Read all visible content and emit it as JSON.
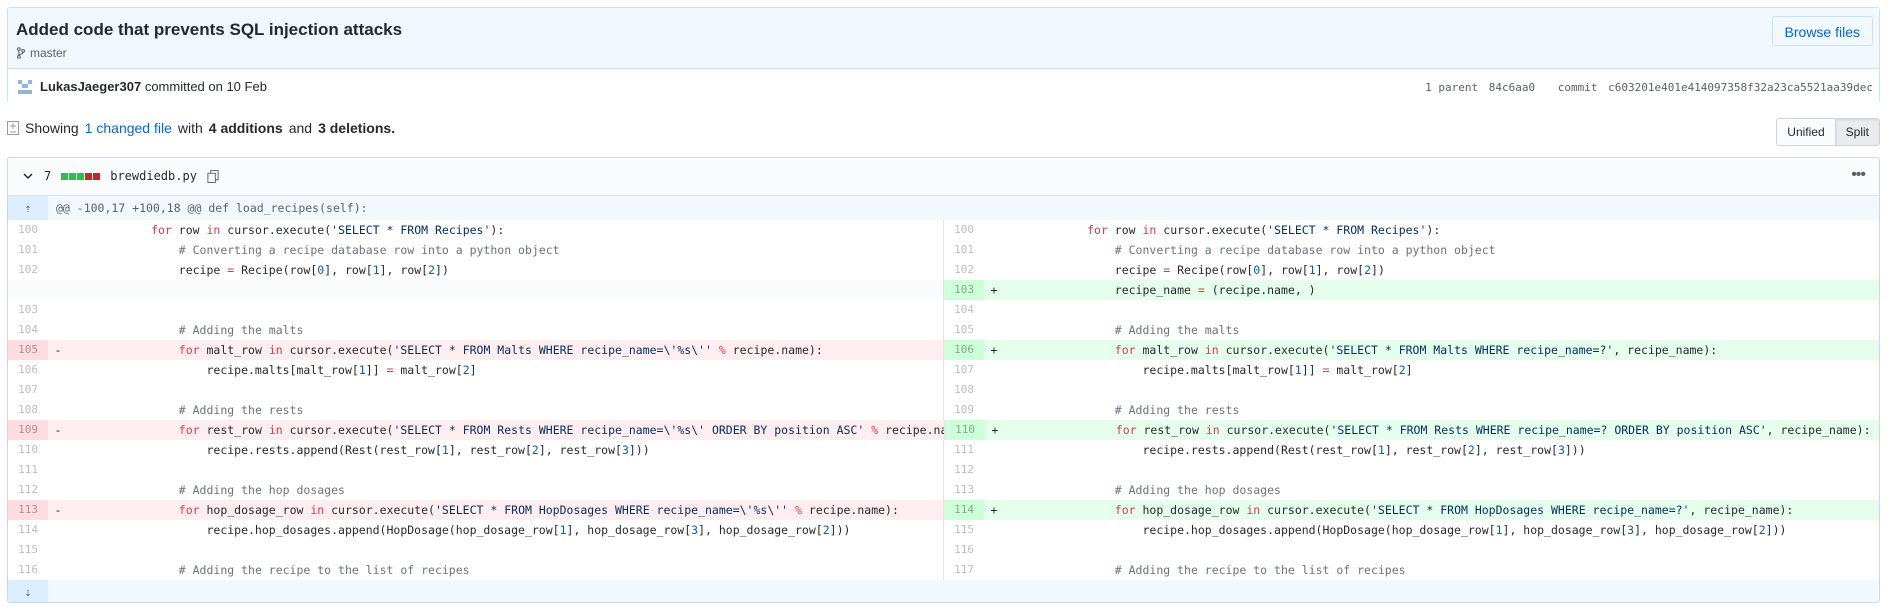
{
  "commit": {
    "title": "Added code that prevents SQL injection attacks",
    "branch": "master",
    "browse_label": "Browse files",
    "author": "LukasJaeger307",
    "committed_text": "committed on 10 Feb",
    "parent_label": "1 parent",
    "parent_sha": "84c6aa0",
    "commit_label": "commit",
    "commit_sha": "c603201e401e414097358f32a23ca5521aa39dec"
  },
  "toc": {
    "prefix": "Showing",
    "changed": "1 changed file",
    "with": "with",
    "additions": "4 additions",
    "and": "and",
    "deletions": "3 deletions."
  },
  "view_toggle": {
    "unified": "Unified",
    "split": "Split"
  },
  "file": {
    "change_count": "7",
    "filename": "brewdiedb.py",
    "hunk_header": "@@ -100,17 +100,18 @@ def load_recipes(self):"
  },
  "colors": {
    "accent": "#0366d6",
    "add": "#e6ffed",
    "del": "#ffeef0"
  },
  "diff_rows": [
    {
      "l": {
        "n": "100",
        "t": "            for row in cursor.execute('SELECT * FROM Recipes'):"
      },
      "r": {
        "n": "100",
        "t": "            for row in cursor.execute('SELECT * FROM Recipes'):"
      }
    },
    {
      "l": {
        "n": "101",
        "t": "                # Converting a recipe database row into a python object"
      },
      "r": {
        "n": "101",
        "t": "                # Converting a recipe database row into a python object"
      }
    },
    {
      "l": {
        "n": "102",
        "t": "                recipe = Recipe(row[0], row[1], row[2])"
      },
      "r": {
        "n": "102",
        "t": "                recipe = Recipe(row[0], row[1], row[2])"
      }
    },
    {
      "l": null,
      "r": {
        "n": "103",
        "s": "+",
        "t": "                recipe_name = (recipe.name, )",
        "k": "add"
      }
    },
    {
      "l": {
        "n": "103",
        "t": ""
      },
      "r": {
        "n": "104",
        "t": ""
      }
    },
    {
      "l": {
        "n": "104",
        "t": "                # Adding the malts"
      },
      "r": {
        "n": "105",
        "t": "                # Adding the malts"
      }
    },
    {
      "l": {
        "n": "105",
        "s": "-",
        "t": "                for malt_row in cursor.execute('SELECT * FROM Malts WHERE recipe_name=\\'%s\\'' % recipe.name):",
        "k": "del"
      },
      "r": {
        "n": "106",
        "s": "+",
        "t": "                for malt_row in cursor.execute('SELECT * FROM Malts WHERE recipe_name=?', recipe_name):",
        "k": "add"
      }
    },
    {
      "l": {
        "n": "106",
        "t": "                    recipe.malts[malt_row[1]] = malt_row[2]"
      },
      "r": {
        "n": "107",
        "t": "                    recipe.malts[malt_row[1]] = malt_row[2]"
      }
    },
    {
      "l": {
        "n": "107",
        "t": ""
      },
      "r": {
        "n": "108",
        "t": ""
      }
    },
    {
      "l": {
        "n": "108",
        "t": "                # Adding the rests"
      },
      "r": {
        "n": "109",
        "t": "                # Adding the rests"
      }
    },
    {
      "l": {
        "n": "109",
        "s": "-",
        "t": "                for rest_row in cursor.execute('SELECT * FROM Rests WHERE recipe_name=\\'%s\\' ORDER BY position ASC' % recipe.name):",
        "k": "del"
      },
      "r": {
        "n": "110",
        "s": "+",
        "t": "                for rest_row in cursor.execute('SELECT * FROM Rests WHERE recipe_name=? ORDER BY position ASC', recipe_name):",
        "k": "add"
      }
    },
    {
      "l": {
        "n": "110",
        "t": "                    recipe.rests.append(Rest(rest_row[1], rest_row[2], rest_row[3]))"
      },
      "r": {
        "n": "111",
        "t": "                    recipe.rests.append(Rest(rest_row[1], rest_row[2], rest_row[3]))"
      }
    },
    {
      "l": {
        "n": "111",
        "t": ""
      },
      "r": {
        "n": "112",
        "t": ""
      }
    },
    {
      "l": {
        "n": "112",
        "t": "                # Adding the hop dosages"
      },
      "r": {
        "n": "113",
        "t": "                # Adding the hop dosages"
      }
    },
    {
      "l": {
        "n": "113",
        "s": "-",
        "t": "                for hop_dosage_row in cursor.execute('SELECT * FROM HopDosages WHERE recipe_name=\\'%s\\'' % recipe.name):",
        "k": "del"
      },
      "r": {
        "n": "114",
        "s": "+",
        "t": "                for hop_dosage_row in cursor.execute('SELECT * FROM HopDosages WHERE recipe_name=?', recipe_name):",
        "k": "add"
      }
    },
    {
      "l": {
        "n": "114",
        "t": "                    recipe.hop_dosages.append(HopDosage(hop_dosage_row[1], hop_dosage_row[3], hop_dosage_row[2]))"
      },
      "r": {
        "n": "115",
        "t": "                    recipe.hop_dosages.append(HopDosage(hop_dosage_row[1], hop_dosage_row[3], hop_dosage_row[2]))"
      }
    },
    {
      "l": {
        "n": "115",
        "t": ""
      },
      "r": {
        "n": "116",
        "t": ""
      }
    },
    {
      "l": {
        "n": "116",
        "t": "                # Adding the recipe to the list of recipes"
      },
      "r": {
        "n": "117",
        "t": "                # Adding the recipe to the list of recipes"
      }
    }
  ]
}
